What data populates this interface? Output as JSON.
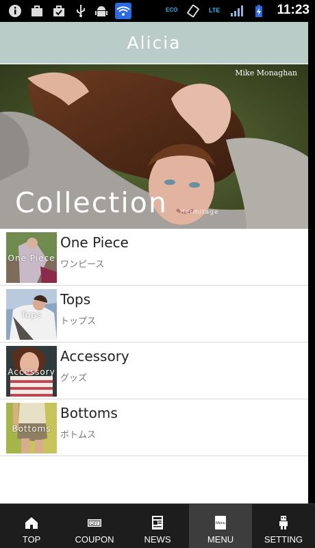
{
  "status_bar": {
    "time": "11:23",
    "icons": [
      "info-icon",
      "briefcase-icon",
      "briefcase-check-icon",
      "usb-icon",
      "android-icon",
      "wifi-icon",
      "eco-icon",
      "rotate-icon",
      "lte-icon",
      "signal-icon",
      "battery-icon"
    ],
    "eco_label": "ECO",
    "lte_label": "LTE"
  },
  "header": {
    "title": "Alicia"
  },
  "hero": {
    "credit": "Mike Monaghan",
    "title": "Collection",
    "subtitle": "Hermitage"
  },
  "categories": [
    {
      "title": "One Piece",
      "subtitle": "ワンピース",
      "thumb_label": "One Piece"
    },
    {
      "title": "Tops",
      "subtitle": "トップス",
      "thumb_label": "Tops"
    },
    {
      "title": "Accessory",
      "subtitle": "グッズ",
      "thumb_label": "Accessory"
    },
    {
      "title": "Bottoms",
      "subtitle": "ボトムス",
      "thumb_label": "Bottoms"
    }
  ],
  "tabs": [
    {
      "label": "TOP",
      "icon": "home-icon",
      "active": false
    },
    {
      "label": "COUPON",
      "icon": "coupon-icon",
      "active": false,
      "icon_text": "OFF"
    },
    {
      "label": "NEWS",
      "icon": "newspaper-icon",
      "active": false
    },
    {
      "label": "MENU",
      "icon": "menu-book-icon",
      "active": true,
      "icon_text": "Menu"
    },
    {
      "label": "SETTING",
      "icon": "robot-setting-icon",
      "active": false
    }
  ],
  "colors": {
    "header_bg": "#b9ccc7",
    "tabbar_bg": "#1d1d1d",
    "tab_active_bg": "#3d3d3d",
    "wifi_bg": "#2a6ae3"
  }
}
